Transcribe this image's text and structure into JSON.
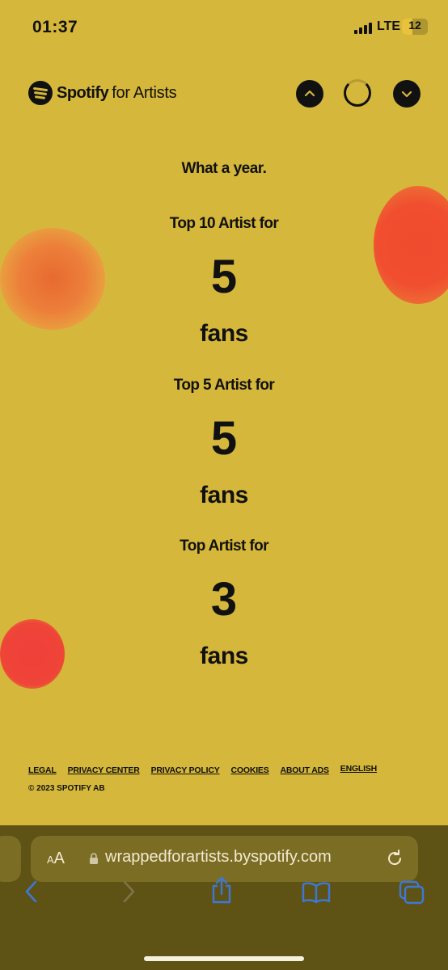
{
  "status_bar": {
    "time": "01:37",
    "network": "LTE",
    "battery": "12"
  },
  "header": {
    "brand": "Spotify",
    "brand_suffix": "for Artists"
  },
  "content": {
    "intro": "What a year.",
    "stats": [
      {
        "label": "Top 10 Artist for",
        "value": "5",
        "unit": "fans"
      },
      {
        "label": "Top 5 Artist for",
        "value": "5",
        "unit": "fans"
      },
      {
        "label": "Top Artist for",
        "value": "3",
        "unit": "fans"
      }
    ]
  },
  "footer": {
    "links": [
      "LEGAL",
      "PRIVACY CENTER",
      "PRIVACY POLICY",
      "COOKIES",
      "ABOUT ADS",
      "ENGLISH"
    ],
    "copyright": "© 2023 SPOTIFY AB"
  },
  "browser": {
    "text_size_label": "AA",
    "url": "wrappedforartists.byspotify.com"
  },
  "colors": {
    "background": "#d5b73b",
    "accent": "#111111",
    "browser_bar": "#5f5215",
    "icon_blue": "#3d78d8"
  },
  "icons": [
    "chevron-up-icon",
    "loading-spinner-icon",
    "chevron-down-icon",
    "lock-icon",
    "reload-icon",
    "back-icon",
    "forward-icon",
    "share-icon",
    "bookmarks-icon",
    "tabs-icon"
  ]
}
